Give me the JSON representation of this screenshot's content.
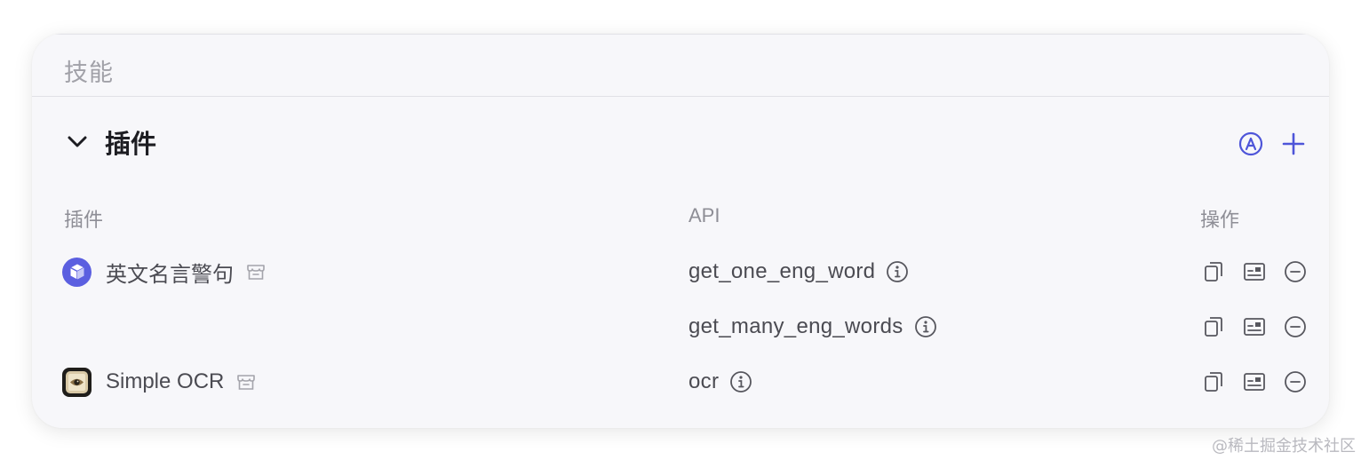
{
  "section": {
    "title": "技能"
  },
  "plugins_group": {
    "title": "插件",
    "chevron_icon": "chevron-down-icon",
    "auto_icon": "circled-a-icon",
    "add_icon": "plus-icon",
    "accent_color": "#4e55d9"
  },
  "columns": {
    "plugin": "插件",
    "api": "API",
    "actions": "操作"
  },
  "rows": [
    {
      "plugin_name": "英文名言警句",
      "plugin_icon": "cube-icon",
      "api": "get_one_eng_word"
    },
    {
      "plugin_name": "",
      "plugin_icon": "",
      "api": "get_many_eng_words"
    },
    {
      "plugin_name": "Simple OCR",
      "plugin_icon": "eye-document-icon",
      "api": "ocr"
    }
  ],
  "row_actions": [
    "copy-icon",
    "card-icon",
    "remove-circle-icon"
  ],
  "watermark": "@稀土掘金技术社区"
}
